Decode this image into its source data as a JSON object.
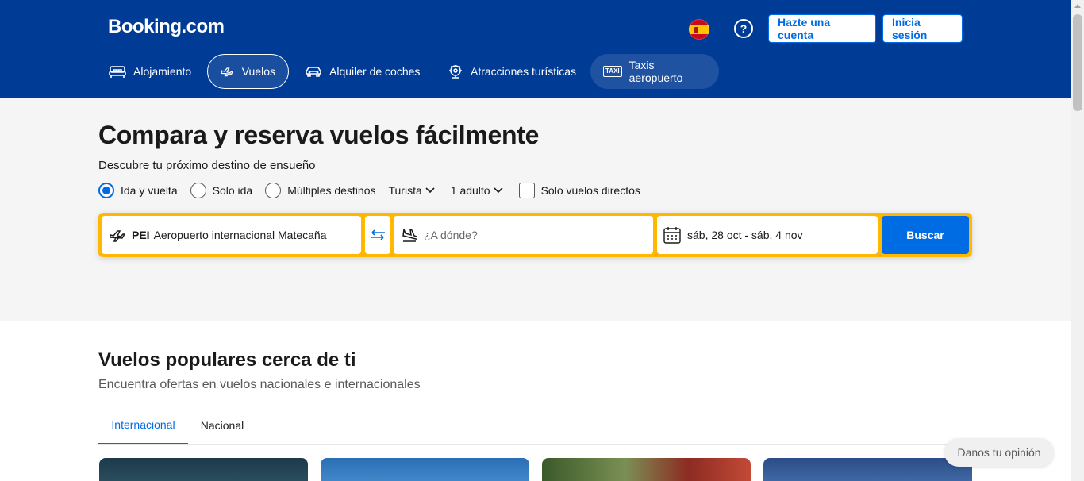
{
  "header": {
    "logo": "Booking.com",
    "language_flag": "spain-flag-icon",
    "help_icon": "?",
    "register_label": "Hazte una cuenta",
    "signin_label": "Inicia sesión",
    "nav": [
      {
        "label": "Alojamiento",
        "icon": "bed-icon"
      },
      {
        "label": "Vuelos",
        "icon": "plane-icon",
        "active": true
      },
      {
        "label": "Alquiler de coches",
        "icon": "car-icon"
      },
      {
        "label": "Atracciones turísticas",
        "icon": "attractions-icon"
      },
      {
        "label": "Taxis aeropuerto",
        "icon": "taxi-icon"
      }
    ],
    "taxi_icon_text": "TAXI"
  },
  "hero": {
    "title": "Compara y reserva vuelos fácilmente",
    "subtitle": "Descubre tu próximo destino de ensueño",
    "trip_types": [
      {
        "label": "Ida y vuelta",
        "selected": true
      },
      {
        "label": "Solo ida",
        "selected": false
      },
      {
        "label": "Múltiples destinos",
        "selected": false
      }
    ],
    "cabin_class": "Turista",
    "passengers": "1 adulto",
    "direct_only_label": "Solo vuelos directos",
    "direct_only_checked": false
  },
  "search": {
    "from_code": "PEI",
    "from_name": "Aeropuerto internacional Matecaña",
    "to_placeholder": "¿A dónde?",
    "dates": "sáb, 28 oct - sáb, 4 nov",
    "button": "Buscar"
  },
  "popular": {
    "title": "Vuelos populares cerca de ti",
    "subtitle": "Encuentra ofertas en vuelos nacionales e internacionales",
    "tabs": [
      {
        "label": "Internacional",
        "active": true
      },
      {
        "label": "Nacional",
        "active": false
      }
    ]
  },
  "feedback_label": "Danos tu opinión",
  "colors": {
    "brand_blue": "#003b95",
    "accent_blue": "#006ce4",
    "search_border": "#ffb700"
  }
}
